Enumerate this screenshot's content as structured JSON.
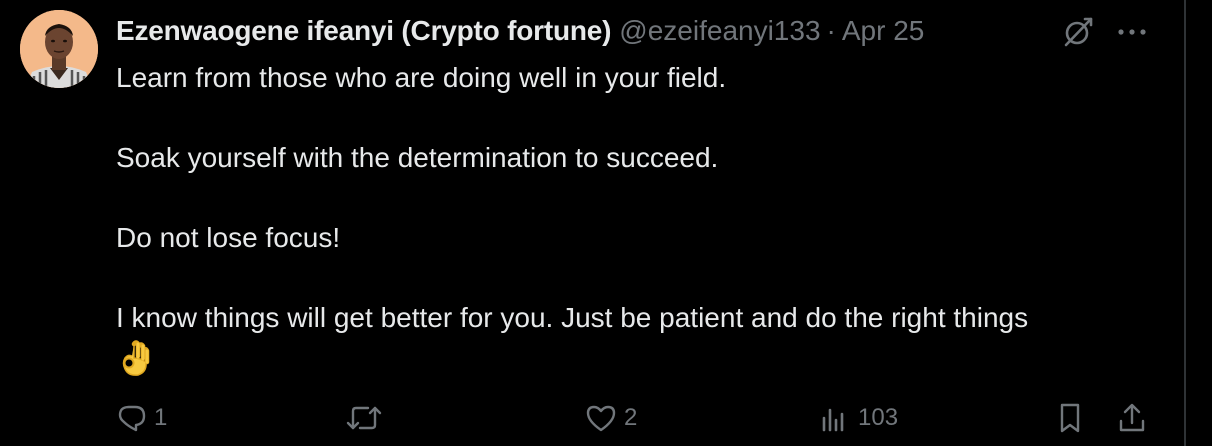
{
  "tweet": {
    "display_name": "Ezenwaogene ifeanyi (Crypto fortune)",
    "handle": "@ezeifeanyi133",
    "separator": "·",
    "date": "Apr 25",
    "lines": [
      "Learn from those who are doing well in your field.",
      "Soak yourself with the determination to succeed.",
      "Do not lose focus!",
      "I know things will get better for you. Just be patient and do the right things"
    ],
    "emoji": "ok-hand-emoji"
  },
  "actions": {
    "reply_count": "1",
    "retweet_count": "",
    "like_count": "2",
    "views_count": "103"
  },
  "icons": {
    "grok": "grok-icon",
    "more": "more-icon",
    "reply": "reply-icon",
    "retweet": "retweet-icon",
    "like": "heart-icon",
    "views": "analytics-icon",
    "bookmark": "bookmark-icon",
    "share": "share-icon"
  },
  "colors": {
    "background": "#000000",
    "text": "#e7e9ea",
    "muted": "#71767b",
    "emoji": "#f7c940"
  }
}
